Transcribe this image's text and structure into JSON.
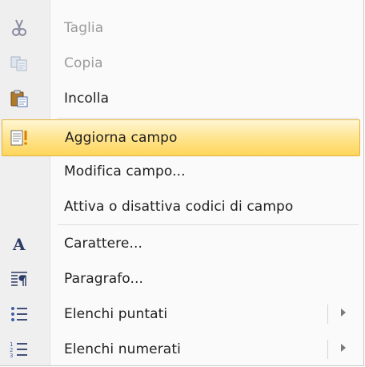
{
  "menu": {
    "items": [
      {
        "label": "Taglia",
        "icon": "scissors-icon",
        "disabled": true
      },
      {
        "label": "Copia",
        "icon": "copy-icon",
        "disabled": true
      },
      {
        "label": "Incolla",
        "icon": "paste-icon",
        "disabled": false
      },
      {
        "label": "Aggiorna campo",
        "icon": "update-field-icon",
        "disabled": false,
        "highlighted": true
      },
      {
        "label": "Modifica campo...",
        "icon": "",
        "disabled": false
      },
      {
        "label": "Attiva o disattiva codici di campo",
        "icon": "",
        "disabled": false
      },
      {
        "label": "Carattere...",
        "icon": "font-icon",
        "disabled": false
      },
      {
        "label": "Paragrafo...",
        "icon": "paragraph-icon",
        "disabled": false
      },
      {
        "label": "Elenchi puntati",
        "icon": "bullets-icon",
        "disabled": false,
        "submenu": true
      },
      {
        "label": "Elenchi numerati",
        "icon": "numbering-icon",
        "disabled": false,
        "submenu": true
      }
    ]
  },
  "colors": {
    "highlight_top": "#fff6d2",
    "highlight_bottom": "#ffd65c",
    "highlight_border": "#e3b23a",
    "gutter": "#efefef",
    "disabled_text": "#9a9a9a"
  }
}
